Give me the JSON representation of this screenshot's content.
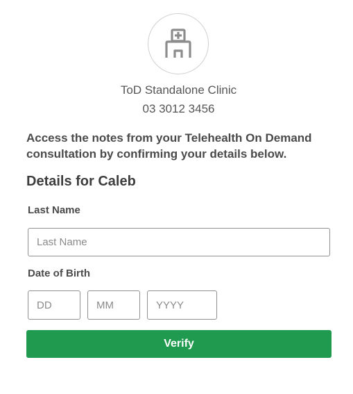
{
  "clinic": {
    "logo_icon": "hospital-building-icon",
    "name": "ToD Standalone Clinic",
    "phone": "03 3012 3456"
  },
  "intro_text": "Access the notes from your Telehealth On Demand consultation by confirming your details below.",
  "details_heading": "Details for Caleb",
  "form": {
    "last_name": {
      "label": "Last Name",
      "placeholder": "Last Name",
      "value": ""
    },
    "dob": {
      "label": "Date of Birth",
      "day_placeholder": "DD",
      "month_placeholder": "MM",
      "year_placeholder": "YYYY"
    },
    "verify_label": "Verify"
  },
  "colors": {
    "accent": "#1f9a4f",
    "icon": "#8c8c8c",
    "border": "#8f8f8f"
  }
}
